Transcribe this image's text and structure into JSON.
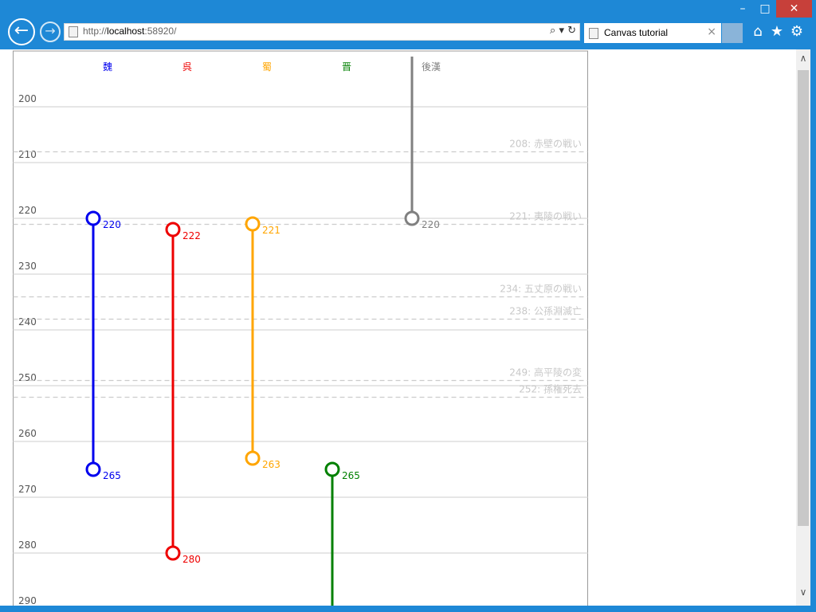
{
  "window": {
    "minimize_glyph": "–",
    "maximize_glyph": "□",
    "close_glyph": "✕"
  },
  "browser": {
    "back_glyph": "←",
    "forward_glyph": "→",
    "url_prefix": "http://",
    "url_host": "localhost",
    "url_rest": ":58920/",
    "url_tools": "⌕ ▾ ↻",
    "tab_title": "Canvas tutorial",
    "tab_close": "×",
    "icons": [
      "home-icon",
      "favorites-icon",
      "settings-icon"
    ],
    "home_glyph": "⌂",
    "fav_glyph": "★",
    "gear_glyph": "⚙",
    "scroll_up": "∧",
    "scroll_down": "∨"
  },
  "chart_data": {
    "type": "timeline",
    "y_ticks": [
      200,
      210,
      220,
      230,
      240,
      250,
      260,
      270,
      280,
      290
    ],
    "ylim": [
      200,
      290
    ],
    "series": [
      {
        "name": "魏",
        "color": "#0000ee",
        "start": 220,
        "end": 265,
        "start_label": "220",
        "end_label": "265"
      },
      {
        "name": "呉",
        "color": "#ee0000",
        "start": 222,
        "end": 280,
        "start_label": "222",
        "end_label": "280"
      },
      {
        "name": "蜀",
        "color": "#ffa500",
        "start": 221,
        "end": 263,
        "start_label": "221",
        "end_label": "263"
      },
      {
        "name": "晋",
        "color": "#008000",
        "start": 265,
        "end": 291,
        "start_label": "265",
        "end_label": ""
      },
      {
        "name": "後漢",
        "color": "#808080",
        "start": 191,
        "end": 220,
        "start_label": "",
        "end_label": "220"
      }
    ],
    "events": [
      {
        "year": 208,
        "label": "208: 赤壁の戦い"
      },
      {
        "year": 221,
        "label": "221: 夷陵の戦い"
      },
      {
        "year": 234,
        "label": "234: 五丈原の戦い"
      },
      {
        "year": 238,
        "label": "238: 公孫淵滅亡"
      },
      {
        "year": 249,
        "label": "249: 高平陵の変"
      },
      {
        "year": 252,
        "label": "252: 孫権死去"
      }
    ]
  }
}
